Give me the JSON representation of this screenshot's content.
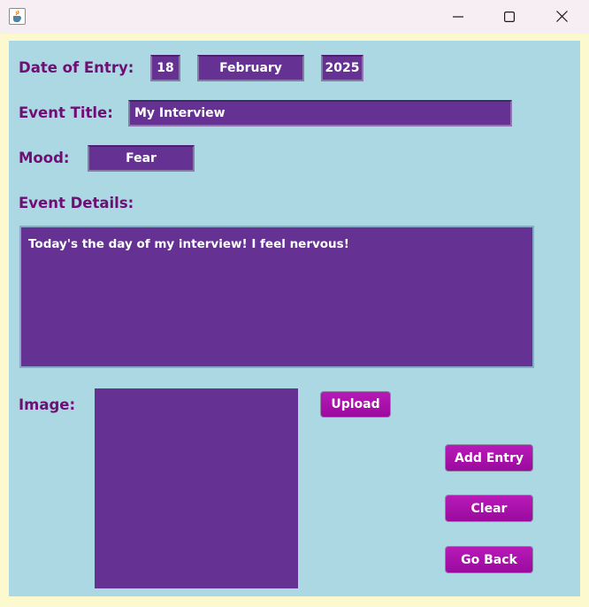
{
  "window": {
    "icons": {
      "app": "java-cup-icon",
      "minimize": "minimize-icon",
      "maximize": "maximize-icon",
      "close": "close-icon"
    }
  },
  "form": {
    "date_label": "Date of Entry:",
    "day": "18",
    "month": "February",
    "year": "2025",
    "title_label": "Event Title:",
    "title_value": "My Interview",
    "mood_label": "Mood:",
    "mood_value": "Fear",
    "details_label": "Event Details:",
    "details_value": "Today's the day of my interview! I feel nervous!",
    "image_label": "Image:"
  },
  "buttons": {
    "upload": "Upload",
    "add_entry": "Add Entry",
    "clear": "Clear",
    "go_back": "Go Back"
  },
  "colors": {
    "panel_background": "#acd8e4",
    "frame_background": "#fcf9cf",
    "label_text": "#6e0f73",
    "field_background": "#653293",
    "button_background": "#a912ab"
  }
}
